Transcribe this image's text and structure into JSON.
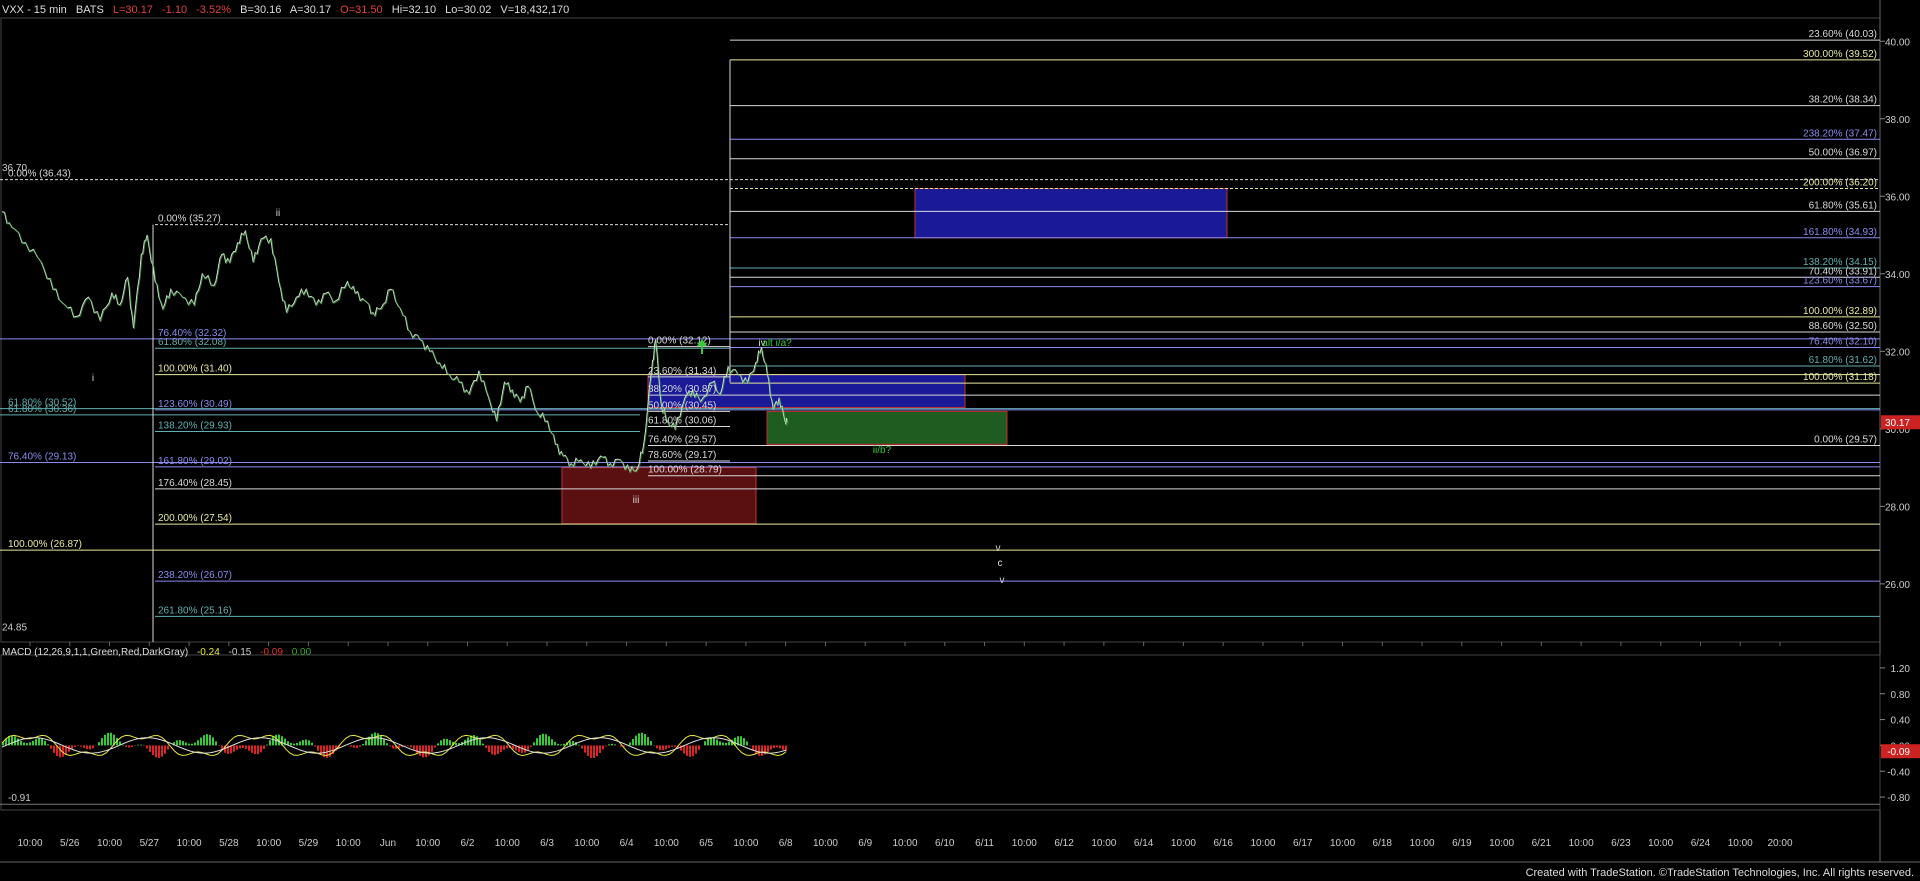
{
  "header": {
    "symbol": "VXX - 15 min",
    "exchange": "BATS",
    "last": "L=30.17",
    "change": "-1.10",
    "change_pct": "-3.52%",
    "bid": "B=30.16",
    "ask": "A=30.17",
    "open": "O=31.50",
    "high": "Hi=32.10",
    "low": "Lo=30.02",
    "volume": "V=18,432,170"
  },
  "colors": {
    "background": "#000000",
    "white_line": "#d8d8d8",
    "yellow_line": "#e8e8a0",
    "blue_line": "#8a8af0",
    "cyan_text": "#5fb0b0",
    "green": "#33cc33",
    "red": "#dd2222",
    "blue_box": "#1a1a99",
    "green_box": "#1f5c1f",
    "red_box": "#5a1010"
  },
  "macd": {
    "label": "MACD (12,26,9,1,1,Green,Red,DarkGray)",
    "values": [
      "-0.24",
      "-0.15",
      "-0.09",
      "0.00"
    ],
    "axis_ticks": [
      "1.20",
      "0.80",
      "0.40",
      "0.00",
      "-0.40",
      "-0.80"
    ],
    "current": "-0.09",
    "left_label": "-0.91"
  },
  "footer": "Created with TradeStation. ©TradeStation Technologies, Inc. All rights reserved.",
  "chart_data": {
    "type": "line",
    "title": "VXX - 15 min",
    "ylim": [
      24.5,
      40.6
    ],
    "y_ticks": [
      "40.00",
      "38.00",
      "36.00",
      "34.00",
      "32.00",
      "30.00",
      "28.00",
      "26.00"
    ],
    "current_price": "30.17",
    "x_tick_labels": [
      "10:00",
      "5/26",
      "10:00",
      "5/27",
      "10:00",
      "5/28",
      "10:00",
      "5/29",
      "10:00",
      "Jun",
      "10:00",
      "6/2",
      "10:00",
      "6/3",
      "10:00",
      "6/4",
      "10:00",
      "6/5",
      "10:00",
      "6/8",
      "10:00",
      "6/9",
      "10:00",
      "6/10",
      "6/11",
      "10:00",
      "6/12",
      "10:00",
      "6/14",
      "10:00",
      "6/16",
      "10:00",
      "6/17",
      "10:00",
      "6/18",
      "10:00",
      "6/19",
      "10:00",
      "6/21",
      "10:00",
      "6/23",
      "10:00",
      "6/24",
      "10:00",
      "20:00"
    ],
    "close_path": [
      [
        0,
        35.6
      ],
      [
        0.5,
        35.2
      ],
      [
        1.2,
        34.8
      ],
      [
        2,
        34.3
      ],
      [
        2.6,
        33.6
      ],
      [
        3.2,
        33.2
      ],
      [
        3.8,
        32.9
      ],
      [
        4.4,
        33.4
      ],
      [
        5,
        32.8
      ],
      [
        5.6,
        33.5
      ],
      [
        6,
        33.2
      ],
      [
        6.4,
        33.9
      ],
      [
        6.7,
        32.6
      ],
      [
        7.1,
        34.5
      ],
      [
        7.4,
        35.0
      ],
      [
        7.8,
        33.8
      ],
      [
        8.2,
        33.1
      ],
      [
        8.6,
        33.6
      ],
      [
        9.2,
        33.4
      ],
      [
        9.8,
        33.2
      ],
      [
        10.2,
        34.0
      ],
      [
        10.8,
        33.7
      ],
      [
        11.2,
        34.5
      ],
      [
        11.6,
        34.3
      ],
      [
        12,
        34.8
      ],
      [
        12.4,
        35.1
      ],
      [
        12.8,
        34.3
      ],
      [
        13.2,
        34.9
      ],
      [
        13.7,
        34.9
      ],
      [
        14.1,
        33.8
      ],
      [
        14.5,
        33.0
      ],
      [
        15,
        33.4
      ],
      [
        15.5,
        33.6
      ],
      [
        16,
        33.2
      ],
      [
        16.5,
        33.5
      ],
      [
        17,
        33.3
      ],
      [
        17.6,
        33.8
      ],
      [
        18,
        33.5
      ],
      [
        18.5,
        33.3
      ],
      [
        18.9,
        33.0
      ],
      [
        19.3,
        33.1
      ],
      [
        19.8,
        33.6
      ],
      [
        20.3,
        33.1
      ],
      [
        20.8,
        32.5
      ],
      [
        21.3,
        32.3
      ],
      [
        21.8,
        32.0
      ],
      [
        22.3,
        31.7
      ],
      [
        22.8,
        31.4
      ],
      [
        23.3,
        31.2
      ],
      [
        23.8,
        30.9
      ],
      [
        24.3,
        31.5
      ],
      [
        24.8,
        30.8
      ],
      [
        25.2,
        30.2
      ],
      [
        25.6,
        31.2
      ],
      [
        26,
        31.0
      ],
      [
        26.4,
        30.7
      ],
      [
        26.8,
        31.1
      ],
      [
        27.3,
        30.4
      ],
      [
        27.8,
        30.2
      ],
      [
        28.2,
        29.6
      ],
      [
        28.6,
        29.3
      ],
      [
        29,
        29.1
      ],
      [
        29.5,
        29.2
      ],
      [
        30,
        29.0
      ],
      [
        30.5,
        29.3
      ],
      [
        31,
        29.1
      ],
      [
        31.5,
        29.2
      ],
      [
        32,
        28.9
      ],
      [
        32.4,
        29.0
      ],
      [
        32.7,
        29.6
      ],
      [
        33.1,
        31.5
      ],
      [
        33.3,
        32.3
      ],
      [
        33.6,
        30.6
      ],
      [
        33.9,
        30.2
      ],
      [
        34.3,
        30.0
      ],
      [
        34.8,
        30.8
      ],
      [
        35.2,
        31.0
      ],
      [
        35.6,
        30.7
      ],
      [
        36.2,
        31.2
      ],
      [
        36.6,
        30.9
      ],
      [
        37,
        31.6
      ],
      [
        37.5,
        31.4
      ],
      [
        38,
        31.2
      ],
      [
        38.4,
        31.7
      ],
      [
        38.7,
        32.1
      ],
      [
        39,
        31.4
      ],
      [
        39.3,
        30.5
      ],
      [
        39.6,
        30.8
      ],
      [
        39.9,
        30.2
      ],
      [
        40,
        30.17
      ]
    ],
    "fib_levels": [
      {
        "label": "23.60% (40.03)",
        "price": 40.03,
        "color": "white"
      },
      {
        "label": "300.00% (39.52)",
        "price": 39.52,
        "color": "yellow"
      },
      {
        "label": "38.20% (38.34)",
        "price": 38.34,
        "color": "white"
      },
      {
        "label": "238.20% (37.47)",
        "price": 37.47,
        "color": "blue"
      },
      {
        "label": "50.00% (36.97)",
        "price": 36.97,
        "color": "white"
      },
      {
        "label": "200.00% (36.20)",
        "price": 36.2,
        "color": "yellow"
      },
      {
        "label": "61.80% (35.61)",
        "price": 35.61,
        "color": "white"
      },
      {
        "label": "161.80% (34.93)",
        "price": 34.93,
        "color": "blue"
      },
      {
        "label": "138.20% (34.15)",
        "price": 34.15,
        "color": "cyan"
      },
      {
        "label": "70.40% (33.91)",
        "price": 33.91,
        "color": "white"
      },
      {
        "label": "123.60% (33.67)",
        "price": 33.67,
        "color": "blue"
      },
      {
        "label": "100.00% (32.89)",
        "price": 32.89,
        "color": "yellow"
      },
      {
        "label": "88.60% (32.50)",
        "price": 32.5,
        "color": "white"
      },
      {
        "label": "76.40% (32.10)",
        "price": 32.1,
        "color": "blue"
      },
      {
        "label": "61.80% (31.62)",
        "price": 31.62,
        "color": "cyan"
      },
      {
        "label": "100.00% (31.18)",
        "price": 31.18,
        "color": "yellow"
      },
      {
        "label": "0.00% (29.57)",
        "price": 29.57,
        "color": "white"
      }
    ],
    "left_fib_levels": [
      {
        "label": "0.00% (35.27)",
        "price": 35.27,
        "color": "white"
      },
      {
        "label": "61.80% (32.08)",
        "price": 32.08,
        "color": "cyan"
      },
      {
        "label": "76.40% (32.32)",
        "price": 32.32,
        "color": "blue"
      },
      {
        "label": "100.00% (31.40)",
        "price": 31.4,
        "color": "yellow"
      },
      {
        "label": "123.60% (30.49)",
        "price": 30.49,
        "color": "blue"
      },
      {
        "label": "138.20% (29.93)",
        "price": 29.93,
        "color": "cyan"
      },
      {
        "label": "161.80% (29.02)",
        "price": 29.02,
        "color": "blue"
      },
      {
        "label": "176.40% (28.45)",
        "price": 28.45,
        "color": "white"
      },
      {
        "label": "200.00% (27.54)",
        "price": 27.54,
        "color": "yellow"
      },
      {
        "label": "238.20% (26.07)",
        "price": 26.07,
        "color": "blue"
      },
      {
        "label": "261.80% (25.16)",
        "price": 25.16,
        "color": "cyan"
      },
      {
        "label": "0.00% (36.43)",
        "price": 36.43,
        "color": "white"
      },
      {
        "label": "61.80% (30.52)",
        "price": 30.52,
        "color": "cyan"
      },
      {
        "label": "61.80% (30.36)",
        "price": 30.36,
        "color": "cyan"
      },
      {
        "label": "76.40% (29.13)",
        "price": 29.13,
        "color": "blue"
      },
      {
        "label": "100.00% (26.87)",
        "price": 26.87,
        "color": "yellow"
      },
      {
        "label": "0.00% (32.12)",
        "price": 32.12,
        "color": "white"
      },
      {
        "label": "23.60% (31.34)",
        "price": 31.34,
        "color": "white"
      },
      {
        "label": "38.20% (30.87)",
        "price": 30.87,
        "color": "white"
      },
      {
        "label": "50.00% (30.45)",
        "price": 30.45,
        "color": "white"
      },
      {
        "label": "61.80% (30.06)",
        "price": 30.06,
        "color": "white"
      },
      {
        "label": "76.40% (29.57)",
        "price": 29.57,
        "color": "white"
      },
      {
        "label": "78.60% (29.17)",
        "price": 29.17,
        "color": "white"
      },
      {
        "label": "100.00% (28.79)",
        "price": 28.79,
        "color": "white"
      }
    ],
    "price_labels": [
      "36.70",
      "24.85"
    ],
    "wave_labels": [
      "i",
      "ii",
      "iii",
      "iv",
      "alt i/a?",
      "ii/b?",
      "v",
      "c",
      "v"
    ],
    "boxes": [
      {
        "name": "upper-blue-zone",
        "color": "blue",
        "price_top": 36.2,
        "price_bottom": 34.93
      },
      {
        "name": "mid-blue-zone",
        "color": "blue",
        "price_top": 31.4,
        "price_bottom": 30.55
      },
      {
        "name": "green-zone",
        "color": "green",
        "price_top": 30.45,
        "price_bottom": 29.6
      },
      {
        "name": "red-zone",
        "color": "red",
        "price_top": 29.0,
        "price_bottom": 27.55
      }
    ]
  }
}
